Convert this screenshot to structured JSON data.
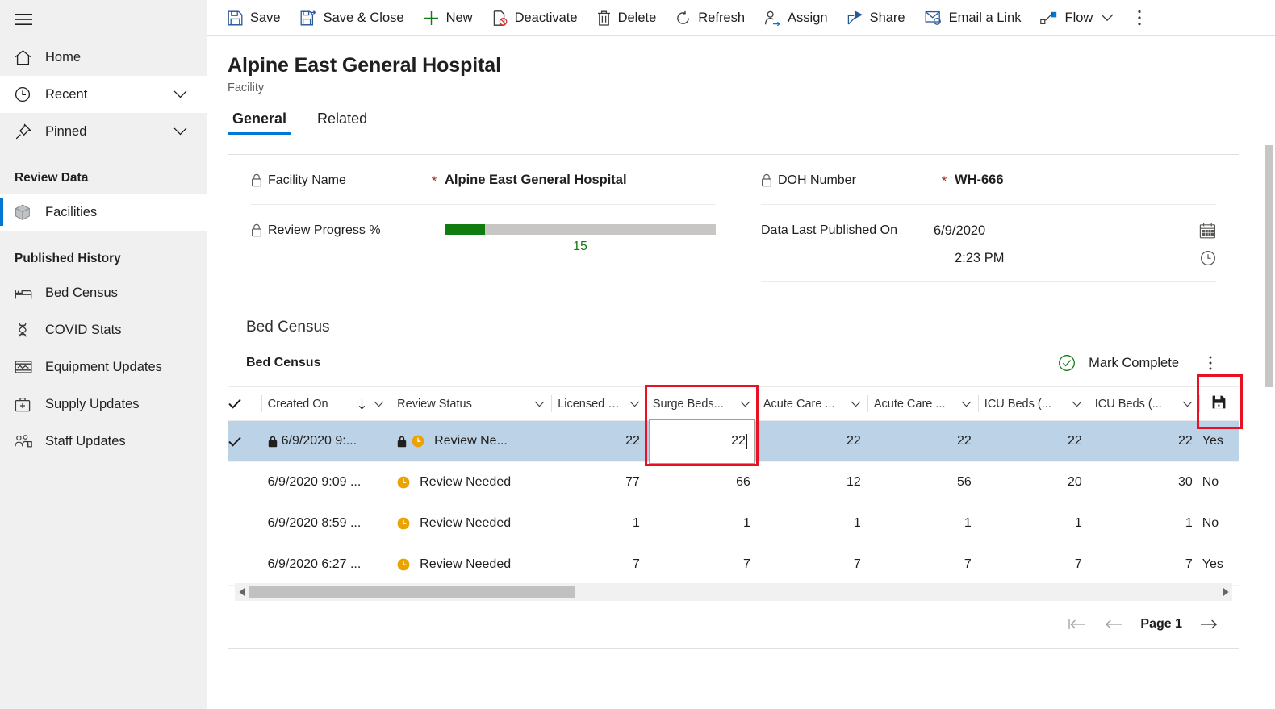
{
  "sidebar": {
    "hamburger_label": "Site map",
    "items": [
      {
        "label": "Home",
        "icon": "home-icon",
        "expandable": false
      },
      {
        "label": "Recent",
        "icon": "clock-icon",
        "expandable": true
      },
      {
        "label": "Pinned",
        "icon": "pin-icon",
        "expandable": true
      }
    ],
    "groups": [
      {
        "title": "Review Data",
        "items": [
          {
            "label": "Facilities",
            "icon": "cube-icon",
            "selected": true
          }
        ]
      },
      {
        "title": "Published History",
        "items": [
          {
            "label": "Bed Census",
            "icon": "bed-icon",
            "selected": false
          },
          {
            "label": "COVID Stats",
            "icon": "dna-icon",
            "selected": false
          },
          {
            "label": "Equipment Updates",
            "icon": "monitor-icon",
            "selected": false
          },
          {
            "label": "Supply Updates",
            "icon": "medkit-icon",
            "selected": false
          },
          {
            "label": "Staff Updates",
            "icon": "people-icon",
            "selected": false
          }
        ]
      }
    ]
  },
  "commandbar": {
    "buttons": [
      {
        "label": "Save",
        "icon": "save-icon"
      },
      {
        "label": "Save & Close",
        "icon": "save-close-icon"
      },
      {
        "label": "New",
        "icon": "plus-icon"
      },
      {
        "label": "Deactivate",
        "icon": "deactivate-icon"
      },
      {
        "label": "Delete",
        "icon": "trash-icon"
      },
      {
        "label": "Refresh",
        "icon": "refresh-icon"
      },
      {
        "label": "Assign",
        "icon": "person-assign-icon"
      },
      {
        "label": "Share",
        "icon": "share-icon"
      },
      {
        "label": "Email a Link",
        "icon": "email-icon"
      },
      {
        "label": "Flow",
        "icon": "flow-icon",
        "has_chevron": true
      }
    ],
    "overflow_label": "More commands"
  },
  "record": {
    "title": "Alpine East General Hospital",
    "subtitle": "Facility",
    "tabs": [
      {
        "label": "General",
        "active": true
      },
      {
        "label": "Related",
        "active": false
      }
    ]
  },
  "form": {
    "facility_name": {
      "label": "Facility Name",
      "required_marker": "*",
      "value": "Alpine East General Hospital"
    },
    "review_progress": {
      "label": "Review Progress %",
      "value": "15",
      "percent": 15,
      "fill_color": "#107c10",
      "track_color": "#c8c6c4"
    },
    "doh_number": {
      "label": "DOH Number",
      "required_marker": "*",
      "value": "WH-666"
    },
    "data_last_published": {
      "label": "Data Last Published On",
      "date": "6/9/2020",
      "time": "2:23 PM",
      "date_icon": "calendar-icon",
      "time_icon": "clock-icon"
    }
  },
  "subgrid": {
    "section_title": "Bed Census",
    "grid_label": "Bed Census",
    "mark_complete_label": "Mark Complete",
    "mark_complete_icon": "check-circle-icon",
    "kebab_label": "More grid commands",
    "save_icon_header": "save-icon",
    "columns": [
      {
        "label": "",
        "key": "check",
        "type": "check"
      },
      {
        "label": "Created On",
        "key": "created_on",
        "sorted": true,
        "sort_dir": "asc",
        "type": "text"
      },
      {
        "label": "Review Status",
        "key": "review_status",
        "type": "text"
      },
      {
        "label": "Licensed B...",
        "key": "licensed_beds",
        "type": "num"
      },
      {
        "label": "Surge Beds...",
        "key": "surge_beds",
        "type": "num",
        "highlighted": true
      },
      {
        "label": "Acute Care ...",
        "key": "acute_care_1",
        "type": "num"
      },
      {
        "label": "Acute Care ...",
        "key": "acute_care_2",
        "type": "num"
      },
      {
        "label": "ICU Beds (...",
        "key": "icu_beds_1",
        "type": "num"
      },
      {
        "label": "ICU Beds (...",
        "key": "icu_beds_2",
        "type": "num"
      },
      {
        "label": "",
        "key": "yesno",
        "type": "text"
      }
    ],
    "rows": [
      {
        "selected": true,
        "locked": true,
        "created_on": "6/9/2020 9:...",
        "status_locked": true,
        "review_status": "Review Ne...",
        "licensed_beds": "22",
        "surge_beds": "22",
        "acute_care_1": "22",
        "acute_care_2": "22",
        "icu_beds_1": "22",
        "icu_beds_2": "22",
        "yesno": "Yes"
      },
      {
        "selected": false,
        "locked": false,
        "created_on": "6/9/2020 9:09 ...",
        "status_locked": false,
        "review_status": "Review Needed",
        "licensed_beds": "77",
        "surge_beds": "66",
        "acute_care_1": "12",
        "acute_care_2": "56",
        "icu_beds_1": "20",
        "icu_beds_2": "30",
        "yesno": "No"
      },
      {
        "selected": false,
        "locked": false,
        "created_on": "6/9/2020 8:59 ...",
        "status_locked": false,
        "review_status": "Review Needed",
        "licensed_beds": "1",
        "surge_beds": "1",
        "acute_care_1": "1",
        "acute_care_2": "1",
        "icu_beds_1": "1",
        "icu_beds_2": "1",
        "yesno": "No"
      },
      {
        "selected": false,
        "locked": false,
        "created_on": "6/9/2020 6:27 ...",
        "status_locked": false,
        "review_status": "Review Needed",
        "licensed_beds": "7",
        "surge_beds": "7",
        "acute_care_1": "7",
        "acute_care_2": "7",
        "icu_beds_1": "7",
        "icu_beds_2": "7",
        "yesno": "Yes"
      }
    ],
    "editing_cell": {
      "column": "Surge Beds...",
      "value": "22",
      "row_index": 0
    },
    "pager": {
      "first_label": "First page",
      "prev_label": "Previous page",
      "page_label": "Page 1",
      "next_label": "Next page"
    }
  },
  "annotations": {
    "highlight_color": "#e81123",
    "boxes": [
      {
        "name": "surge-beds-column-highlight"
      },
      {
        "name": "grid-save-button-highlight"
      }
    ]
  }
}
